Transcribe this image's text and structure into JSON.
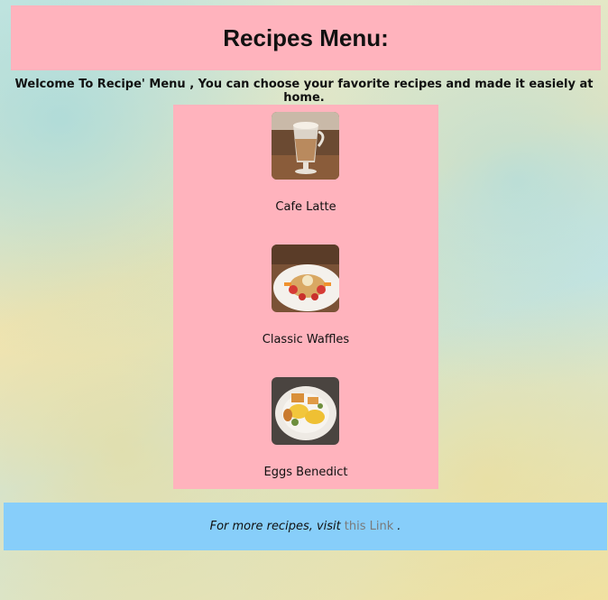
{
  "header": {
    "title": "Recipes Menu:"
  },
  "welcome_text": "Welcome To Recipe' Menu , You can choose your favorite recipes and made it easiely at home.",
  "menu": {
    "items": [
      {
        "label": "Cafe Latte",
        "image": "cafe-latte-photo"
      },
      {
        "label": "Classic Waffles",
        "image": "classic-waffles-photo"
      },
      {
        "label": "Eggs Benedict",
        "image": "eggs-benedict-photo"
      }
    ]
  },
  "footer": {
    "text_before": "For more recipes, visit",
    "link_text": "this Link",
    "text_after": "."
  },
  "colors": {
    "header_bg": "#ffb3bd",
    "panel_bg": "#ffb3bd",
    "footer_bg": "#87cefa",
    "link_color": "#7a7a7a"
  }
}
